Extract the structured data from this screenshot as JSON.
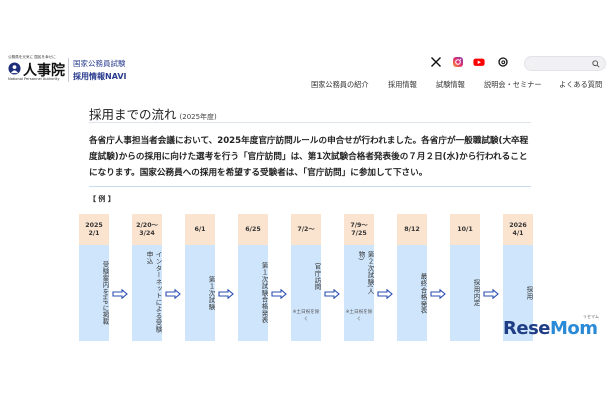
{
  "header": {
    "logo": {
      "tagline": "公務員を元気に 国民を幸せに",
      "name": "人事院",
      "english": "National Personnel Authority"
    },
    "site": {
      "line1": "国家公務員試験",
      "line2": "採用情報NAVI"
    },
    "social": [
      "x-icon",
      "instagram-icon",
      "youtube-icon",
      "threads-icon"
    ],
    "search": {
      "value": "",
      "placeholder": ""
    },
    "nav": [
      "国家公務員の紹介",
      "採用情報",
      "試験情報",
      "説明会・セミナー",
      "よくある質問"
    ]
  },
  "main": {
    "title": "採用までの流れ",
    "title_year": "(2025年度)",
    "description": "各省庁人事担当者会議において、2025年度官庁訪問ルールの申合せが行われました。各省庁が一般職試験(大卒程度試験)からの採用に向けた選考を行う「官庁訪問」は、第1次試験合格者発表後の７月２日(水)から行われることになります。国家公務員への採用を希望する受験者は、「官庁訪問」に参加して下さい。",
    "example_label": "【 例 】",
    "flow": [
      {
        "date1": "2025",
        "date2": "2/1",
        "text": "受験案内をHPに掲載",
        "note": ""
      },
      {
        "date1": "2/20〜",
        "date2": "3/24",
        "text": "インターネットによる受験申込",
        "note": ""
      },
      {
        "date1": "6/1",
        "date2": "",
        "text": "第１次試験",
        "note": ""
      },
      {
        "date1": "6/25",
        "date2": "",
        "text": "第１次試験合格発表",
        "note": ""
      },
      {
        "date1": "7/2〜",
        "date2": "",
        "text": "官庁訪問",
        "note": "※土日祝を除く"
      },
      {
        "date1": "7/9〜",
        "date2": "7/25",
        "text": "第２次試験(人物)",
        "note": "※土日祝を除く"
      },
      {
        "date1": "8/12",
        "date2": "",
        "text": "最終合格発表",
        "note": ""
      },
      {
        "date1": "10/1",
        "date2": "",
        "text": "採用内定",
        "note": ""
      },
      {
        "date1": "2026",
        "date2": "4/1",
        "text": "採用",
        "note": ""
      }
    ]
  },
  "watermark": {
    "yomi": "リセマム",
    "text_a": "Rese",
    "text_b": "Mom"
  },
  "colors": {
    "brand": "#2a3c8f",
    "column_body": "#cfe5fb",
    "column_head": "#fbe4cf",
    "arrow": "#2b4fb3",
    "watermark": "#1f3d85"
  }
}
